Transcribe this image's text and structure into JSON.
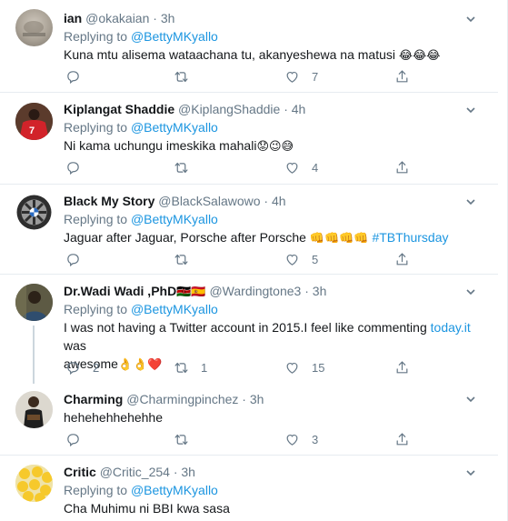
{
  "tweets": [
    {
      "name": "ian",
      "handle": "@okakaian",
      "dot": "·",
      "time": "3h",
      "replying_prefix": "Replying to",
      "replying_to": "@BettyMKyallo",
      "text": "Kuna mtu alisema wataachana tu, akanyeshewa na matusi",
      "emojis": "😂😂😂",
      "replies": "",
      "retweets": "",
      "likes": "7"
    },
    {
      "name": "Kiplangat Shaddie",
      "handle": "@KiplangShaddie",
      "dot": "·",
      "time": "4h",
      "replying_prefix": "Replying to",
      "replying_to": "@BettyMKyallo",
      "text": "Ni kama uchungu imeskika mahali",
      "emojis": "😟😉😅",
      "replies": "",
      "retweets": "",
      "likes": "4"
    },
    {
      "name": "Black My Story",
      "handle": "@BlackSalawowo",
      "dot": "·",
      "time": "4h",
      "replying_prefix": "Replying to",
      "replying_to": "@BettyMKyallo",
      "text": "Jaguar after Jaguar,  Porsche after Porsche",
      "emojis": "👊👊👊👊",
      "hashtag": "#TBThursday",
      "replies": "",
      "retweets": "",
      "likes": "5"
    },
    {
      "name": "Dr.Wadi Wadi ,PhD",
      "name_flags": "🇰🇪🇪🇸",
      "handle": "@Wardingtone3",
      "dot": "·",
      "time": "3h",
      "replying_prefix": "Replying to",
      "replying_to": "@BettyMKyallo",
      "text": "I was not having a Twitter account in 2015.I feel like commenting",
      "link": "today.it",
      "text_after_link": "was",
      "text_line2": "awesome",
      "emojis": "👌👌❤️",
      "replies": "2",
      "retweets": "1",
      "likes": "15"
    },
    {
      "name": "Charming",
      "handle": "@Charmingpinchez",
      "dot": "·",
      "time": "3h",
      "text": "hehehehhehehhe",
      "replies": "",
      "retweets": "",
      "likes": "3"
    },
    {
      "name": "Critic",
      "handle": "@Critic_254",
      "dot": "·",
      "time": "3h",
      "replying_prefix": "Replying to",
      "replying_to": "@BettyMKyallo",
      "text": "Cha Muhimu ni BBI kwa sasa"
    }
  ],
  "colors": {
    "link": "#1b95e0",
    "muted": "#657786",
    "like_heart": "#e0245e"
  },
  "icons": {
    "reply": "reply-icon",
    "retweet": "retweet-icon",
    "like": "heart-icon",
    "share": "share-icon",
    "more": "chevron-down-icon"
  }
}
